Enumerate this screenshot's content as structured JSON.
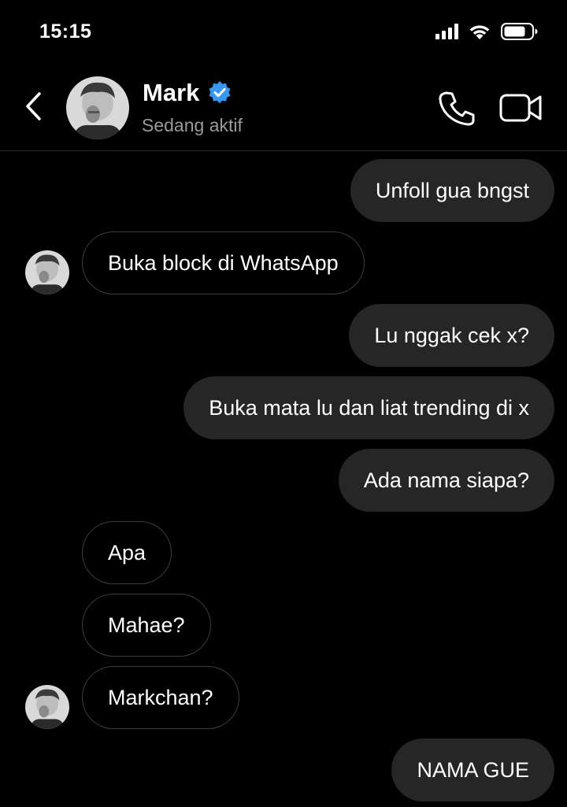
{
  "status_bar": {
    "time": "15:15"
  },
  "header": {
    "contact_name": "Mark",
    "contact_status": "Sedang aktif",
    "verified_color": "#3897f0"
  },
  "messages": [
    {
      "direction": "outgoing",
      "text": "Unfoll gua bngst"
    },
    {
      "direction": "incoming",
      "text": "Buka block di WhatsApp",
      "show_avatar": true
    },
    {
      "direction": "outgoing",
      "text": "Lu nggak cek x?"
    },
    {
      "direction": "outgoing",
      "text": "Buka mata lu dan liat trending di x"
    },
    {
      "direction": "outgoing",
      "text": "Ada nama siapa?"
    },
    {
      "direction": "incoming",
      "text": "Apa",
      "show_avatar": false
    },
    {
      "direction": "incoming",
      "text": "Mahae?",
      "show_avatar": false
    },
    {
      "direction": "incoming",
      "text": "Markchan?",
      "show_avatar": true
    },
    {
      "direction": "outgoing",
      "text": "NAMA GUE"
    }
  ],
  "colors": {
    "background": "#000000",
    "outgoing_bubble": "#262626",
    "incoming_border": "#3d3d3d",
    "secondary_text": "#9a9a9a"
  }
}
